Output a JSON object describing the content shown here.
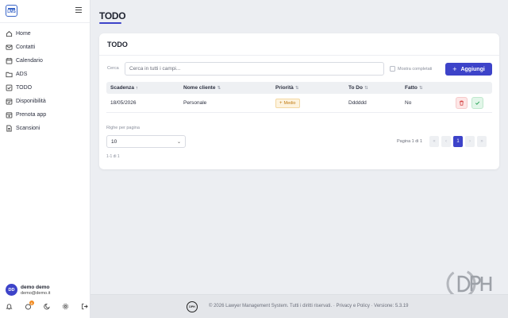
{
  "app": {
    "logo_text": "LMS"
  },
  "sidebar": {
    "items": [
      {
        "label": "Home",
        "icon": "home-icon"
      },
      {
        "label": "Contatti",
        "icon": "mail-icon"
      },
      {
        "label": "Calendario",
        "icon": "calendar-icon"
      },
      {
        "label": "ADS",
        "icon": "folder-icon"
      },
      {
        "label": "TODO",
        "icon": "checkbox-icon"
      },
      {
        "label": "Disponibilità",
        "icon": "calendar-check-icon"
      },
      {
        "label": "Prenota app",
        "icon": "booking-icon"
      },
      {
        "label": "Scansioni",
        "icon": "document-icon"
      }
    ],
    "user": {
      "initials": "DD",
      "name": "demo demo",
      "email": "demo@demo.it"
    },
    "notification_count": "8"
  },
  "page": {
    "title": "TODO"
  },
  "card": {
    "title": "TODO",
    "search_label": "Cerca",
    "search_placeholder": "Cerca in tutti i campi...",
    "show_completed_label": "Mostra completati",
    "add_button_label": "Aggiungi"
  },
  "table": {
    "headers": [
      "Scadenza",
      "Nome cliente",
      "Priorità",
      "To Do",
      "Fatto"
    ],
    "rows": [
      {
        "scadenza": "18/05/2026",
        "cliente": "Personale",
        "priorita": "Medio",
        "todo": "Dddddd",
        "fatto": "No"
      }
    ]
  },
  "pagination": {
    "rows_per_page_label": "Righe per pagina",
    "rows_per_page_value": "10",
    "range_text": "1-1 di 1",
    "page_info": "Pagina 1 di 1",
    "current_page": "1"
  },
  "footer": {
    "logo_text": "DPH",
    "text": "© 2026 Lawyer Management System. Tutti i diritti riservati. · Privacy e Policy · Versione: 5.3.19"
  },
  "colors": {
    "accent": "#3d43c9",
    "priority_medium": "#c07a12",
    "delete": "#d43c3c",
    "done": "#27a356"
  }
}
